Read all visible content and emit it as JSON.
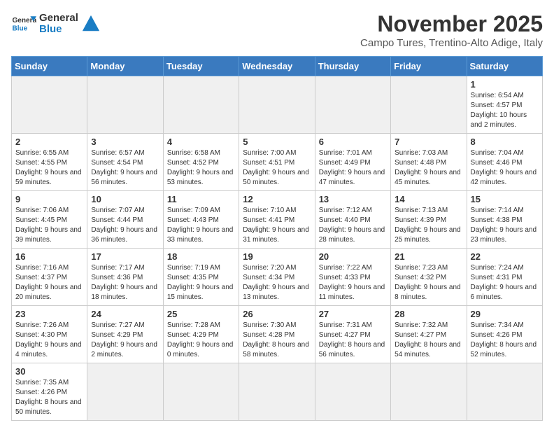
{
  "header": {
    "logo_general": "General",
    "logo_blue": "Blue",
    "title": "November 2025",
    "subtitle": "Campo Tures, Trentino-Alto Adige, Italy"
  },
  "weekdays": [
    "Sunday",
    "Monday",
    "Tuesday",
    "Wednesday",
    "Thursday",
    "Friday",
    "Saturday"
  ],
  "weeks": [
    [
      {
        "day": null,
        "info": ""
      },
      {
        "day": null,
        "info": ""
      },
      {
        "day": null,
        "info": ""
      },
      {
        "day": null,
        "info": ""
      },
      {
        "day": null,
        "info": ""
      },
      {
        "day": null,
        "info": ""
      },
      {
        "day": "1",
        "info": "Sunrise: 6:54 AM\nSunset: 4:57 PM\nDaylight: 10 hours and 2 minutes."
      }
    ],
    [
      {
        "day": "2",
        "info": "Sunrise: 6:55 AM\nSunset: 4:55 PM\nDaylight: 9 hours and 59 minutes."
      },
      {
        "day": "3",
        "info": "Sunrise: 6:57 AM\nSunset: 4:54 PM\nDaylight: 9 hours and 56 minutes."
      },
      {
        "day": "4",
        "info": "Sunrise: 6:58 AM\nSunset: 4:52 PM\nDaylight: 9 hours and 53 minutes."
      },
      {
        "day": "5",
        "info": "Sunrise: 7:00 AM\nSunset: 4:51 PM\nDaylight: 9 hours and 50 minutes."
      },
      {
        "day": "6",
        "info": "Sunrise: 7:01 AM\nSunset: 4:49 PM\nDaylight: 9 hours and 47 minutes."
      },
      {
        "day": "7",
        "info": "Sunrise: 7:03 AM\nSunset: 4:48 PM\nDaylight: 9 hours and 45 minutes."
      },
      {
        "day": "8",
        "info": "Sunrise: 7:04 AM\nSunset: 4:46 PM\nDaylight: 9 hours and 42 minutes."
      }
    ],
    [
      {
        "day": "9",
        "info": "Sunrise: 7:06 AM\nSunset: 4:45 PM\nDaylight: 9 hours and 39 minutes."
      },
      {
        "day": "10",
        "info": "Sunrise: 7:07 AM\nSunset: 4:44 PM\nDaylight: 9 hours and 36 minutes."
      },
      {
        "day": "11",
        "info": "Sunrise: 7:09 AM\nSunset: 4:43 PM\nDaylight: 9 hours and 33 minutes."
      },
      {
        "day": "12",
        "info": "Sunrise: 7:10 AM\nSunset: 4:41 PM\nDaylight: 9 hours and 31 minutes."
      },
      {
        "day": "13",
        "info": "Sunrise: 7:12 AM\nSunset: 4:40 PM\nDaylight: 9 hours and 28 minutes."
      },
      {
        "day": "14",
        "info": "Sunrise: 7:13 AM\nSunset: 4:39 PM\nDaylight: 9 hours and 25 minutes."
      },
      {
        "day": "15",
        "info": "Sunrise: 7:14 AM\nSunset: 4:38 PM\nDaylight: 9 hours and 23 minutes."
      }
    ],
    [
      {
        "day": "16",
        "info": "Sunrise: 7:16 AM\nSunset: 4:37 PM\nDaylight: 9 hours and 20 minutes."
      },
      {
        "day": "17",
        "info": "Sunrise: 7:17 AM\nSunset: 4:36 PM\nDaylight: 9 hours and 18 minutes."
      },
      {
        "day": "18",
        "info": "Sunrise: 7:19 AM\nSunset: 4:35 PM\nDaylight: 9 hours and 15 minutes."
      },
      {
        "day": "19",
        "info": "Sunrise: 7:20 AM\nSunset: 4:34 PM\nDaylight: 9 hours and 13 minutes."
      },
      {
        "day": "20",
        "info": "Sunrise: 7:22 AM\nSunset: 4:33 PM\nDaylight: 9 hours and 11 minutes."
      },
      {
        "day": "21",
        "info": "Sunrise: 7:23 AM\nSunset: 4:32 PM\nDaylight: 9 hours and 8 minutes."
      },
      {
        "day": "22",
        "info": "Sunrise: 7:24 AM\nSunset: 4:31 PM\nDaylight: 9 hours and 6 minutes."
      }
    ],
    [
      {
        "day": "23",
        "info": "Sunrise: 7:26 AM\nSunset: 4:30 PM\nDaylight: 9 hours and 4 minutes."
      },
      {
        "day": "24",
        "info": "Sunrise: 7:27 AM\nSunset: 4:29 PM\nDaylight: 9 hours and 2 minutes."
      },
      {
        "day": "25",
        "info": "Sunrise: 7:28 AM\nSunset: 4:29 PM\nDaylight: 9 hours and 0 minutes."
      },
      {
        "day": "26",
        "info": "Sunrise: 7:30 AM\nSunset: 4:28 PM\nDaylight: 8 hours and 58 minutes."
      },
      {
        "day": "27",
        "info": "Sunrise: 7:31 AM\nSunset: 4:27 PM\nDaylight: 8 hours and 56 minutes."
      },
      {
        "day": "28",
        "info": "Sunrise: 7:32 AM\nSunset: 4:27 PM\nDaylight: 8 hours and 54 minutes."
      },
      {
        "day": "29",
        "info": "Sunrise: 7:34 AM\nSunset: 4:26 PM\nDaylight: 8 hours and 52 minutes."
      }
    ],
    [
      {
        "day": "30",
        "info": "Sunrise: 7:35 AM\nSunset: 4:26 PM\nDaylight: 8 hours and 50 minutes."
      },
      {
        "day": null,
        "info": ""
      },
      {
        "day": null,
        "info": ""
      },
      {
        "day": null,
        "info": ""
      },
      {
        "day": null,
        "info": ""
      },
      {
        "day": null,
        "info": ""
      },
      {
        "day": null,
        "info": ""
      }
    ]
  ]
}
